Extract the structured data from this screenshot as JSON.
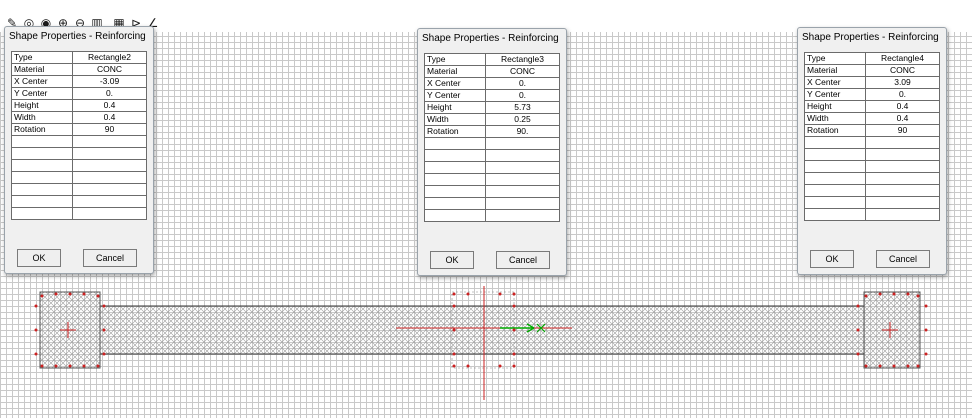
{
  "toolbar": {
    "icons": [
      {
        "name": "pencil-icon",
        "glyph": "✎"
      },
      {
        "name": "circle-dot-icon",
        "glyph": "◎"
      },
      {
        "name": "filled-circle-icon",
        "glyph": "◉"
      },
      {
        "name": "circle-plus-icon",
        "glyph": "⊕"
      },
      {
        "name": "circle-minus-icon",
        "glyph": "⊖"
      },
      {
        "name": "bars-icon",
        "glyph": "▥"
      },
      {
        "name": "grid-icon",
        "glyph": "▦"
      },
      {
        "name": "flag-icon",
        "glyph": "⊳"
      },
      {
        "name": "angle-icon",
        "glyph": "∠"
      }
    ]
  },
  "dialogs": [
    {
      "title": "Shape Properties - Reinforcing",
      "rows": [
        {
          "key": "Type",
          "value": "Rectangle2"
        },
        {
          "key": "Material",
          "value": "CONC"
        },
        {
          "key": "X Center",
          "value": "-3.09"
        },
        {
          "key": "Y Center",
          "value": "0."
        },
        {
          "key": "Height",
          "value": "0.4"
        },
        {
          "key": "Width",
          "value": "0.4"
        },
        {
          "key": "Rotation",
          "value": "90"
        }
      ],
      "ok_label": "OK",
      "cancel_label": "Cancel"
    },
    {
      "title": "Shape Properties - Reinforcing",
      "rows": [
        {
          "key": "Type",
          "value": "Rectangle3"
        },
        {
          "key": "Material",
          "value": "CONC"
        },
        {
          "key": "X Center",
          "value": "0."
        },
        {
          "key": "Y Center",
          "value": "0."
        },
        {
          "key": "Height",
          "value": "5.73"
        },
        {
          "key": "Width",
          "value": "0.25"
        },
        {
          "key": "Rotation",
          "value": "90."
        }
      ],
      "ok_label": "OK",
      "cancel_label": "Cancel"
    },
    {
      "title": "Shape Properties - Reinforcing",
      "rows": [
        {
          "key": "Type",
          "value": "Rectangle4"
        },
        {
          "key": "Material",
          "value": "CONC"
        },
        {
          "key": "X Center",
          "value": "3.09"
        },
        {
          "key": "Y Center",
          "value": "0."
        },
        {
          "key": "Height",
          "value": "0.4"
        },
        {
          "key": "Width",
          "value": "0.4"
        },
        {
          "key": "Rotation",
          "value": "90"
        }
      ],
      "ok_label": "OK",
      "cancel_label": "Cancel"
    }
  ],
  "colors": {
    "grid": "#c9c9c9",
    "rebar": "#cc2222",
    "outline": "#333333",
    "axis_x": "#00aa00",
    "axis_y": "#cc2222"
  }
}
